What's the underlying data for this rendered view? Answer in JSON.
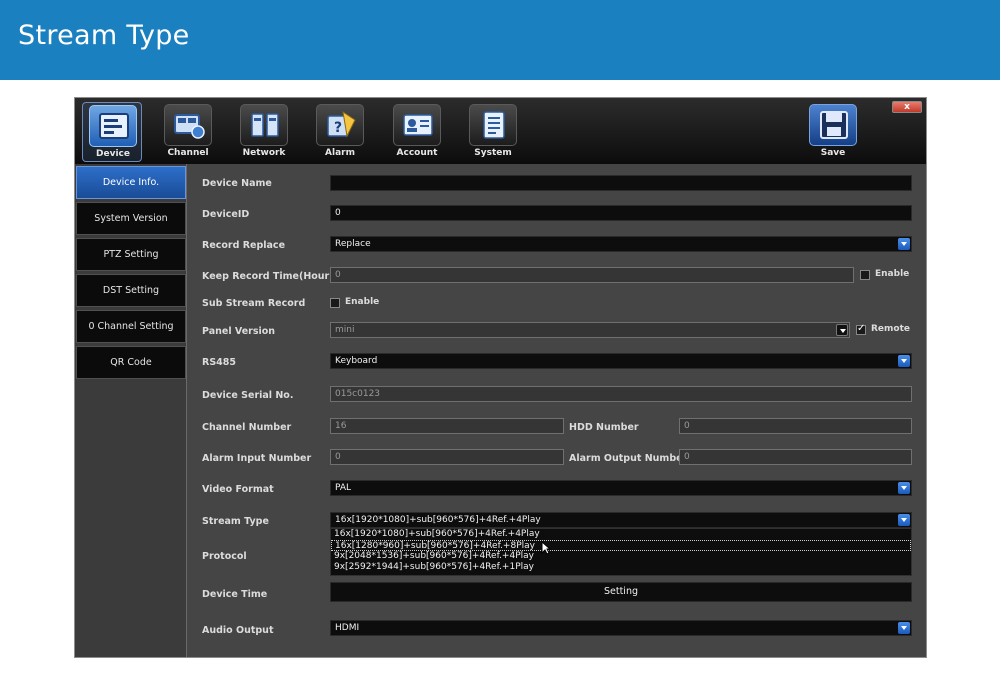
{
  "slide": {
    "title": "Stream Type"
  },
  "toolbar": {
    "close": "x",
    "items": [
      {
        "label": "Device",
        "icon": "device-icon"
      },
      {
        "label": "Channel",
        "icon": "channel-icon"
      },
      {
        "label": "Network",
        "icon": "network-icon"
      },
      {
        "label": "Alarm",
        "icon": "alarm-icon"
      },
      {
        "label": "Account",
        "icon": "account-icon"
      },
      {
        "label": "System",
        "icon": "system-icon"
      }
    ],
    "save": "Save"
  },
  "sidebar": {
    "items": [
      "Device Info.",
      "System Version",
      "PTZ Setting",
      "DST Setting",
      "0 Channel Setting",
      "QR Code"
    ]
  },
  "form": {
    "device_name": {
      "label": "Device Name",
      "value": ""
    },
    "device_id": {
      "label": "DeviceID",
      "value": "0"
    },
    "record_replace": {
      "label": "Record Replace",
      "value": "Replace"
    },
    "keep_record": {
      "label": "Keep Record Time(Hour)",
      "value": "0",
      "check_label": "Enable"
    },
    "sub_stream": {
      "label": "Sub Stream Record",
      "check_label": "Enable"
    },
    "panel_version": {
      "label": "Panel Version",
      "value": "mini",
      "check_label": "Remote"
    },
    "rs485": {
      "label": "RS485",
      "value": "Keyboard"
    },
    "serial": {
      "label": "Device Serial No.",
      "value": "015c0123"
    },
    "channel_number": {
      "label": "Channel Number",
      "value": "16"
    },
    "hdd_number": {
      "label": "HDD Number",
      "value": "0"
    },
    "alarm_input": {
      "label": "Alarm Input Number",
      "value": "0"
    },
    "alarm_output": {
      "label": "Alarm Output Number",
      "value": "0"
    },
    "video_format": {
      "label": "Video Format",
      "value": "PAL"
    },
    "stream_type": {
      "label": "Stream Type",
      "value": "16x[1920*1080]+sub[960*576]+4Ref.+4Play",
      "options": [
        "16x[1920*1080]+sub[960*576]+4Ref.+4Play",
        "16x[1280*960]+sub[960*576]+4Ref.+8Play",
        "9x[2048*1536]+sub[960*576]+4Ref.+4Play",
        "9x[2592*1944]+sub[960*576]+4Ref.+1Play"
      ]
    },
    "protocol": {
      "label": "Protocol"
    },
    "device_time": {
      "label": "Device Time",
      "button": "Setting"
    },
    "audio_output": {
      "label": "Audio Output",
      "value": "HDMI"
    }
  }
}
